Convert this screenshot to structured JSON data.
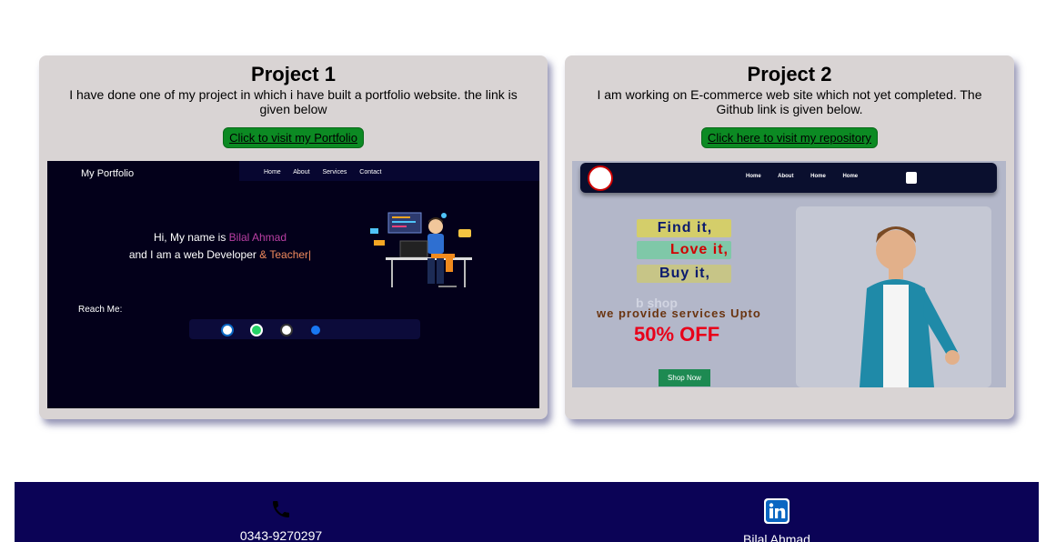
{
  "projects": [
    {
      "title": "Project 1",
      "description": "I have done one of my project in which i have built a portfolio website. the link is given below",
      "link_label": "Click to visit my Portfolio",
      "preview": {
        "brand": "My Portfolio",
        "nav": [
          "Home",
          "About",
          "Services",
          "Contact"
        ],
        "greeting_prefix": "Hi, My name is ",
        "greeting_name": "Bilal Ahmad",
        "role_prefix": "and I am a web Developer ",
        "role_highlight": "& Teacher|",
        "reach_label": "Reach Me:",
        "social_icons": [
          "linkedin-icon",
          "whatsapp-icon",
          "github-icon",
          "facebook-icon"
        ]
      }
    },
    {
      "title": "Project 2",
      "description": "I am working on E-commerce web site which not yet completed. The Github link is given below.",
      "link_label": "Click here to visit my repository",
      "preview": {
        "nav": [
          "Home",
          "About",
          "Home",
          "Home"
        ],
        "tags": [
          "Find it,",
          "Love it,",
          "Buy it,"
        ],
        "watermark": "b shop",
        "promo": "we provide services Upto",
        "discount": "50% OFF",
        "cta": "Shop Now"
      }
    }
  ],
  "footer": {
    "phone": "0343-9270297",
    "linkedin_name": "Bilal Ahmad"
  },
  "colors": {
    "card_bg": "#d9d4d4",
    "link_button": "#0c8a23",
    "footer_bg": "#0b0356",
    "portfolio_bg": "#03001a",
    "accent_pink": "#b93fa3",
    "accent_orange": "#f08a5d",
    "discount_red": "#e8001a"
  }
}
